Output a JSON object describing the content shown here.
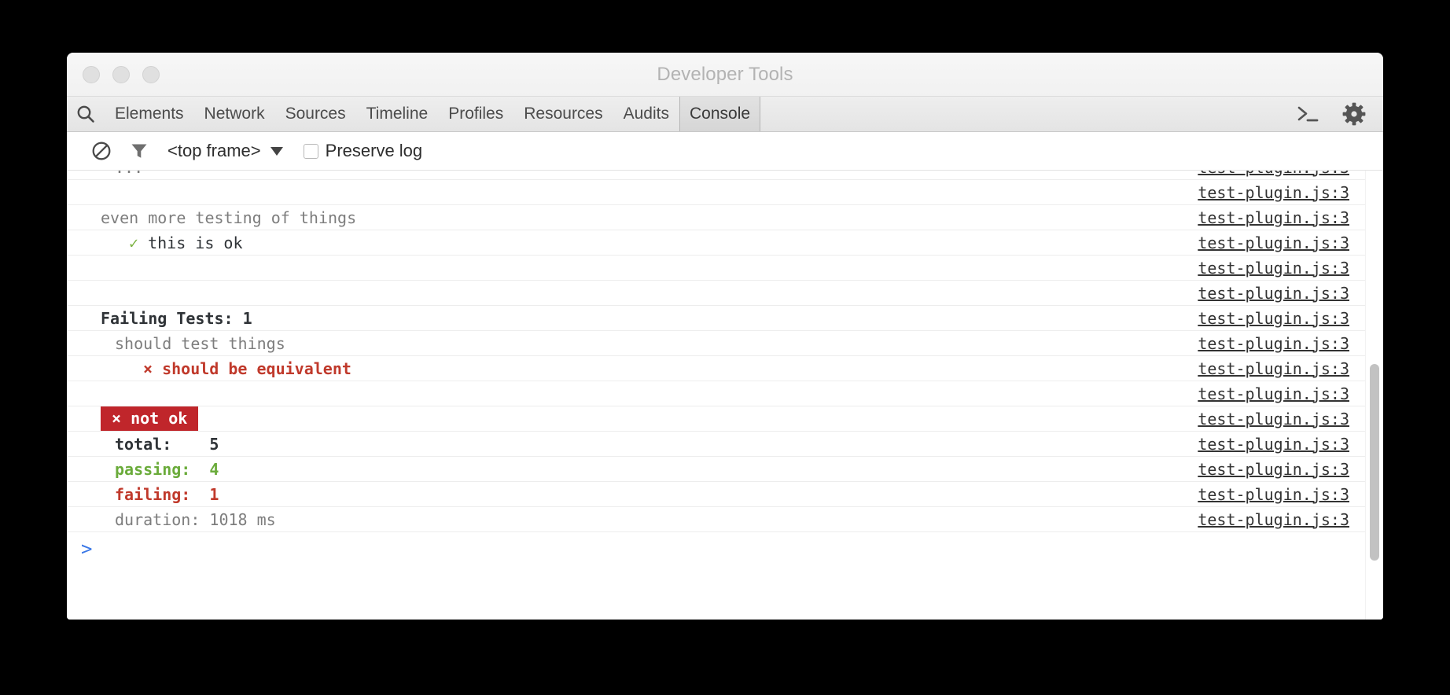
{
  "window": {
    "title": "Developer Tools",
    "traffic_lights": [
      "close",
      "minimize",
      "zoom"
    ]
  },
  "tabstrip": {
    "search_icon": "search-icon",
    "tabs": [
      {
        "label": "Elements",
        "selected": false
      },
      {
        "label": "Network",
        "selected": false
      },
      {
        "label": "Sources",
        "selected": false
      },
      {
        "label": "Timeline",
        "selected": false
      },
      {
        "label": "Profiles",
        "selected": false
      },
      {
        "label": "Resources",
        "selected": false
      },
      {
        "label": "Audits",
        "selected": false
      },
      {
        "label": "Console",
        "selected": true
      }
    ],
    "right_icons": [
      {
        "name": "console-drawer-icon",
        "glyph": ">_"
      },
      {
        "name": "settings-gear-icon",
        "glyph": "gear"
      }
    ]
  },
  "console_toolbar": {
    "clear_icon": "clear-console-icon",
    "filter_icon": "filter-funnel-icon",
    "frame_selector": {
      "value": "<top frame>",
      "caret": "chevron-down-icon"
    },
    "preserve_log": {
      "label": "Preserve log",
      "checked": false
    }
  },
  "console": {
    "source_link": "test-plugin.js:3",
    "messages": [
      {
        "text": "...",
        "style": "gray",
        "indent": 2,
        "clipped": true
      },
      {
        "text": "",
        "style": "gray",
        "indent": 0
      },
      {
        "text": "even more testing of things",
        "style": "gray",
        "indent": 1
      },
      {
        "text": "✓ this is ok",
        "style": "check",
        "indent": 3
      },
      {
        "text": "",
        "style": "gray",
        "indent": 0
      },
      {
        "text": "",
        "style": "gray",
        "indent": 0
      },
      {
        "text": "Failing Tests: 1",
        "style": "dark",
        "indent": 1
      },
      {
        "text": "should test things",
        "style": "gray",
        "indent": 2
      },
      {
        "text": "× should be equivalent",
        "style": "red",
        "indent": 4
      },
      {
        "text": "",
        "style": "gray",
        "indent": 0
      },
      {
        "text": "× not ok",
        "style": "badge",
        "indent": 1
      },
      {
        "text": "total:    5",
        "style": "dark",
        "indent": 2
      },
      {
        "text": "passing:  4",
        "style": "green",
        "indent": 2
      },
      {
        "text": "failing:  1",
        "style": "red",
        "indent": 2
      },
      {
        "text": "duration: 1018 ms",
        "style": "gray",
        "indent": 2
      }
    ],
    "prompt": ">"
  },
  "colors": {
    "pass_green": "#6aab3a",
    "fail_red": "#c0392b",
    "badge_red": "#c0262b",
    "text_dark": "#2f3337",
    "text_gray": "#7d7d7d",
    "prompt_blue": "#3b78e7",
    "link": "#333333"
  }
}
